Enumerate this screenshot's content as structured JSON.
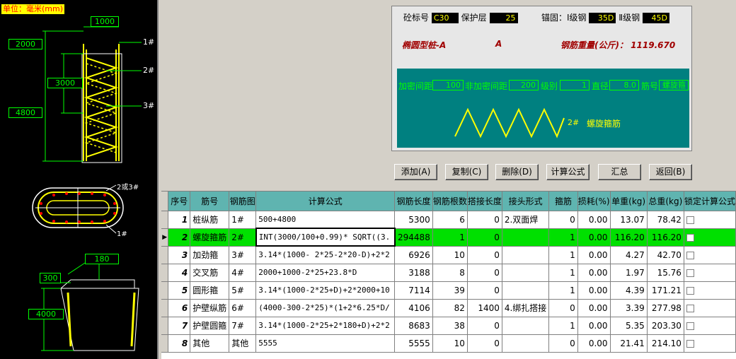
{
  "drawing": {
    "unit": "单位：毫米(mm)",
    "dims": {
      "top_width": "1000",
      "left_upper": "2000",
      "mid": "3000",
      "left_lower": "4800",
      "bottom_width": "180",
      "wall": "300",
      "wall_height": "4000"
    },
    "marks": {
      "m1": "1#",
      "m2": "2#",
      "m3": "3#",
      "m4": "2或3#",
      "m5": "1#"
    }
  },
  "params": {
    "concrete_label": "砼标号",
    "concrete_value": "C30",
    "cover_label": "保护层",
    "cover_value": "25",
    "anchor_label": "锚固：Ⅰ级钢",
    "anchor1_value": "35D",
    "anchor2_label": "Ⅱ级钢",
    "anchor2_value": "45D",
    "type_title": "椭圆型桩-A",
    "type_code": "A",
    "weight_label": "钢筋重量(公斤)：",
    "weight_value": "1119.670"
  },
  "preview": {
    "dense_label": "加密间距",
    "dense_value": "100",
    "nondense_label": "非加密间距",
    "nondense_value": "200",
    "grade_label": "级别",
    "grade_value": "1",
    "diameter_label": "直径",
    "diameter_value": "8.0",
    "barno_label": "筋号",
    "barno_value": "螺旋箍",
    "shape_mark": "2#",
    "shape_name": "螺旋箍筋"
  },
  "buttons": {
    "add": "添加(A)",
    "copy": "复制(C)",
    "delete": "删除(D)",
    "formula": "计算公式",
    "summary": "汇总",
    "back": "返回(B)"
  },
  "grid": {
    "headers": [
      "序号",
      "筋号",
      "钢筋图",
      "计算公式",
      "钢筋长度",
      "钢筋根数",
      "搭接长度",
      "接头形式",
      "箍筋",
      "损耗(%)",
      "单重(kg)",
      "总重(kg)",
      "锁定计算公式"
    ],
    "rows": [
      [
        "1",
        "桩纵筋",
        "1#",
        "500+4800",
        "5300",
        "6",
        "0",
        "2.双面焊",
        "0",
        "0.00",
        "13.07",
        "78.42"
      ],
      [
        "2",
        "螺旋箍筋",
        "2#",
        "INT(3000/100+0.99)* SQRT((3.",
        "294488",
        "1",
        "0",
        "",
        "1",
        "0.00",
        "116.20",
        "116.20"
      ],
      [
        "3",
        "加劲箍",
        "3#",
        "3.14*(1000- 2*25-2*20-D)+2*2",
        "6926",
        "10",
        "0",
        "",
        "1",
        "0.00",
        "4.27",
        "42.70"
      ],
      [
        "4",
        "交叉筋",
        "4#",
        "2000+1000-2*25+23.8*D",
        "3188",
        "8",
        "0",
        "",
        "1",
        "0.00",
        "1.97",
        "15.76"
      ],
      [
        "5",
        "圆形箍",
        "5#",
        "3.14*(1000-2*25+D)+2*2000+10",
        "7114",
        "39",
        "0",
        "",
        "1",
        "0.00",
        "4.39",
        "171.21"
      ],
      [
        "6",
        "护壁纵筋",
        "6#",
        "(4000-300-2*25)*(1+2*6.25*D/",
        "4106",
        "82",
        "1400",
        "4.绑扎搭接",
        "0",
        "0.00",
        "3.39",
        "277.98"
      ],
      [
        "7",
        "护壁圆箍",
        "7#",
        "3.14*(1000-2*25+2*180+D)+2*2",
        "8683",
        "38",
        "0",
        "",
        "1",
        "0.00",
        "5.35",
        "203.30"
      ],
      [
        "8",
        "其他",
        "其他",
        "5555",
        "5555",
        "10",
        "0",
        "",
        "0",
        "0.00",
        "21.41",
        "214.10"
      ]
    ]
  },
  "colors": {
    "grid_header": "#5fb4b0",
    "selected_row": "#00e000",
    "preview_bg": "#008080"
  }
}
